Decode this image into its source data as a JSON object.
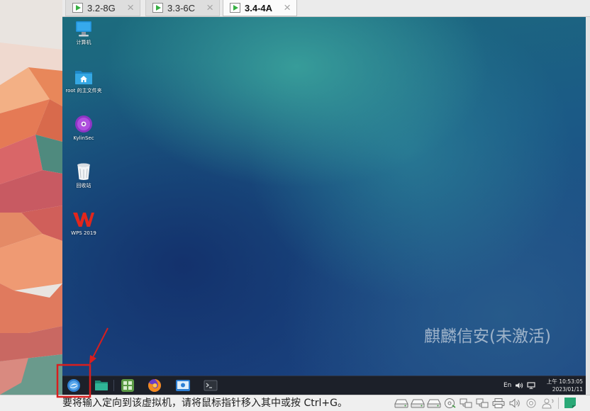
{
  "window": {
    "tab_close_glyph": "×",
    "tabs": [
      {
        "label": "3.2-8G",
        "icon": "vm-powered-on-icon",
        "active": false
      },
      {
        "label": "3.3-6C",
        "icon": "vm-powered-on-icon",
        "active": false
      },
      {
        "label": "3.4-4A",
        "icon": "vm-powered-on-icon",
        "active": true
      }
    ]
  },
  "desktop": {
    "icons": [
      {
        "label": "计算机",
        "icon": "computer-icon"
      },
      {
        "label": "root 的主文件夹",
        "icon": "home-folder-icon"
      },
      {
        "label": "KylinSec",
        "icon": "disc-icon"
      },
      {
        "label": "回收站",
        "icon": "trash-icon"
      },
      {
        "label": "WPS 2019",
        "icon": "wps-icon"
      }
    ],
    "watermark": "麒麟信安(未激活)"
  },
  "taskbar": {
    "items": [
      {
        "icon": "start-menu-icon"
      },
      {
        "icon": "file-manager-icon"
      },
      {
        "icon": "app-center-icon"
      },
      {
        "icon": "firefox-icon"
      },
      {
        "icon": "control-center-icon"
      },
      {
        "icon": "terminal-icon"
      }
    ],
    "tray": {
      "input_method": "En",
      "icons": [
        "volume-icon",
        "display-icon"
      ],
      "time": "上午 10:53:05",
      "date": "2023/01/11"
    }
  },
  "status_bar": {
    "message": "要将输入定向到该虚拟机，请将鼠标指针移入其中或按 Ctrl+G。",
    "devices": [
      "hard-disk-icon",
      "hard-disk-icon",
      "hard-disk-icon",
      "cd-dvd-icon",
      "network-adapter-icon",
      "network-adapter-icon",
      "printer-icon",
      "sound-card-icon",
      "camera-icon",
      "user-icon",
      "message-log-icon"
    ]
  },
  "annotations": {
    "highlight_target": "start-menu-icon",
    "color": "#d91e1e"
  },
  "colors": {
    "taskbar_bg": "#1c2029",
    "tab_active_bg": "#fbfbfb",
    "device_status_green": "#3a9a3a",
    "wallpaper_teal": "#1c6c7d",
    "wallpaper_blue": "#1b4a84"
  }
}
